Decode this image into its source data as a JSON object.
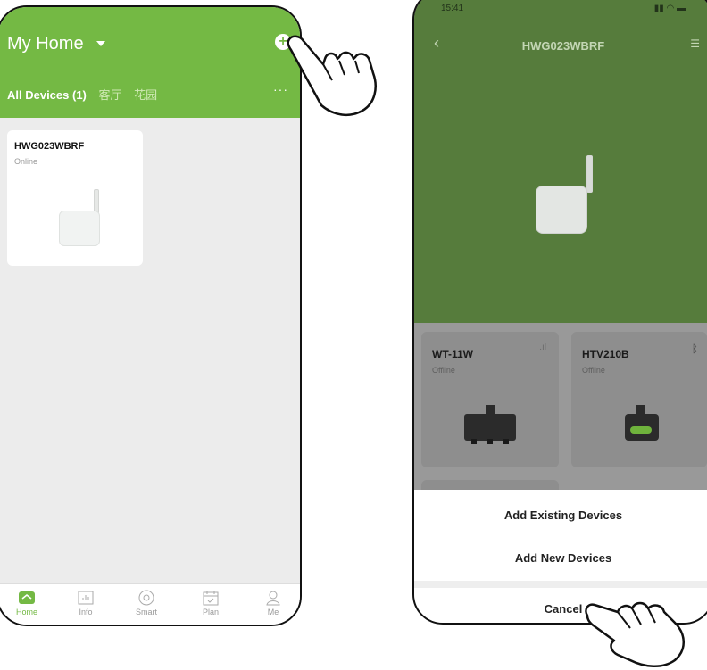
{
  "left_screen": {
    "header": {
      "home_title": "My Home",
      "add_icon": "plus-circle-icon",
      "tabs": [
        {
          "label": "All Devices (1)",
          "active": true
        },
        {
          "label": "客厅",
          "active": false
        },
        {
          "label": "花园",
          "active": false
        }
      ],
      "more_label": "···"
    },
    "device_card": {
      "name": "HWG023WBRF",
      "status": "Online"
    },
    "tabbar": [
      {
        "label": "Home",
        "icon": "home-icon",
        "active": true
      },
      {
        "label": "Info",
        "icon": "chart-icon",
        "active": false
      },
      {
        "label": "Smart",
        "icon": "smart-icon",
        "active": false
      },
      {
        "label": "Plan",
        "icon": "calendar-icon",
        "active": false
      },
      {
        "label": "Me",
        "icon": "person-icon",
        "active": false
      }
    ],
    "accent_color": "#74b944"
  },
  "right_screen": {
    "status_bar": {
      "time": "15:41"
    },
    "header": {
      "back_icon": "chevron-left-icon",
      "title": "HWG023WBRF",
      "settings_icon": "settings-icon"
    },
    "sub_devices": [
      {
        "name": "WT-11W",
        "status": "Offline",
        "icon": "signal-icon"
      },
      {
        "name": "HTV210B",
        "status": "Offline",
        "icon": "bluetooth-icon"
      }
    ],
    "action_sheet": {
      "option_1": "Add Existing Devices",
      "option_2": "Add New Devices",
      "cancel": "Cancel"
    }
  }
}
